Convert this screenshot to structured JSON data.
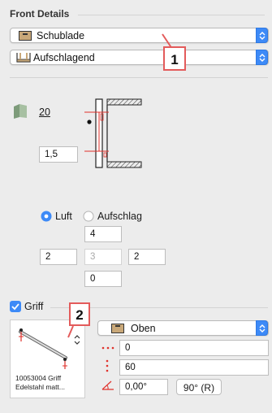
{
  "front_details": {
    "section_title": "Front Details",
    "type_popup": {
      "value": "Schublade",
      "icon": "drawer-icon"
    },
    "mount_popup": {
      "value": "Aufschlagend",
      "icon": "overlay-mount-icon"
    },
    "callout_1": "1",
    "material": {
      "value": "20",
      "icon": "material-swatch-icon"
    },
    "thickness_field": "1,5",
    "radio_options": [
      {
        "label": "Luft",
        "selected": true
      },
      {
        "label": "Aufschlag",
        "selected": false
      }
    ],
    "gap_fields": {
      "top": "4",
      "left": "2",
      "center": "3",
      "right": "2",
      "bottom": "0"
    }
  },
  "griff": {
    "checkbox_label": "Griff",
    "checked": true,
    "callout_2": "2",
    "preview_caption_line1": "10053004 Griff",
    "preview_caption_line2": "Edelstahl matt...",
    "position_popup": {
      "value": "Oben",
      "icon": "handle-top-icon"
    },
    "offset_field": "0",
    "height_field": "60",
    "angle_field": "0,00°",
    "rotate_button": "90° (R)"
  },
  "colors": {
    "accent": "#3d8af7",
    "callout_border": "#e35b5b",
    "dimension_red": "#e0302a"
  }
}
